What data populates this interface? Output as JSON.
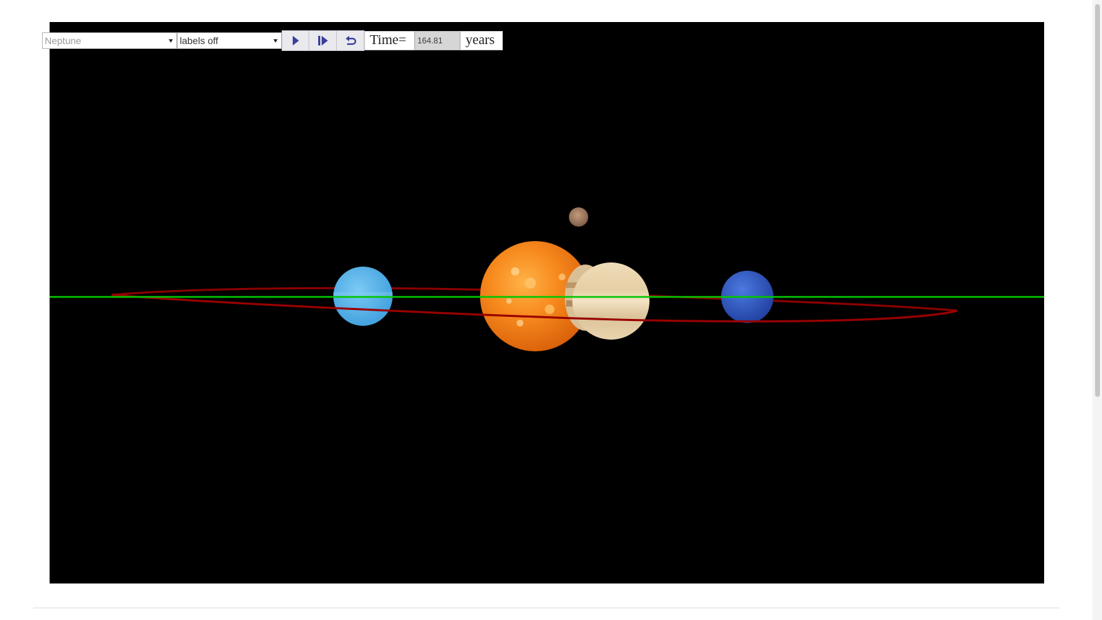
{
  "toolbar": {
    "planet_select": {
      "value": "Neptune"
    },
    "labels_select": {
      "value": "labels off"
    },
    "play_button": {
      "icon": "play-icon"
    },
    "step_button": {
      "icon": "step-forward-icon"
    },
    "reset_button": {
      "icon": "reset-icon"
    },
    "time_label": "Time=",
    "time_value": "164.81",
    "time_unit": "years"
  },
  "scene": {
    "background_color": "#000000",
    "ecliptic_line_color": "#00c800",
    "orbit_color": "#8b0000",
    "bodies": [
      {
        "name": "Sun",
        "color": "#f5821f"
      },
      {
        "name": "Saturn",
        "color": "#e8d2a8"
      },
      {
        "name": "Uranus",
        "color": "#5ab4ec"
      },
      {
        "name": "Neptune",
        "color": "#3a5fcd"
      },
      {
        "name": "Mars",
        "color": "#a27d64"
      }
    ]
  }
}
